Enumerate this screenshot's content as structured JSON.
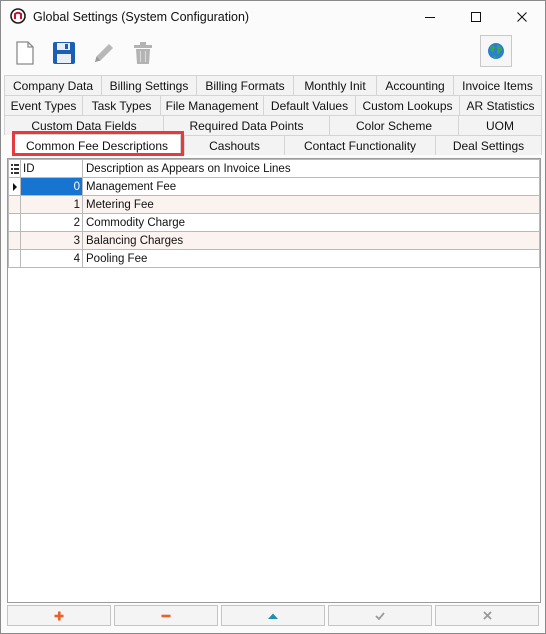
{
  "window": {
    "title": "Global Settings (System Configuration)"
  },
  "tabs": {
    "row1": [
      "Company Data",
      "Billing Settings",
      "Billing Formats",
      "Monthly Init",
      "Accounting",
      "Invoice Items"
    ],
    "row2": [
      "Event Types",
      "Task Types",
      "File Management",
      "Default Values",
      "Custom Lookups",
      "AR Statistics"
    ],
    "row3": [
      "Custom Data Fields",
      "Required Data Points",
      "Color Scheme",
      "UOM"
    ],
    "row4": [
      "Common Fee Descriptions",
      "Cashouts",
      "Contact Functionality",
      "Deal Settings"
    ],
    "active": "Common Fee Descriptions"
  },
  "grid": {
    "columns": [
      "ID",
      "Description as Appears on Invoice Lines"
    ],
    "rows": [
      {
        "id": "0",
        "description": "Management Fee",
        "selected": true
      },
      {
        "id": "1",
        "description": "Metering Fee"
      },
      {
        "id": "2",
        "description": "Commodity Charge"
      },
      {
        "id": "3",
        "description": "Balancing Charges"
      },
      {
        "id": "4",
        "description": "Pooling Fee"
      }
    ]
  },
  "icons": {
    "toolbar": [
      "new-file-icon",
      "save-icon",
      "edit-pencil-icon",
      "delete-trash-icon"
    ],
    "bottom": [
      "add-icon",
      "remove-icon",
      "move-up-icon",
      "confirm-check-icon",
      "cancel-x-icon"
    ]
  },
  "colors": {
    "highlight": "#e53a3f",
    "selection": "#1874d1",
    "save": "#1a5fb4",
    "add": "#e8602c"
  }
}
